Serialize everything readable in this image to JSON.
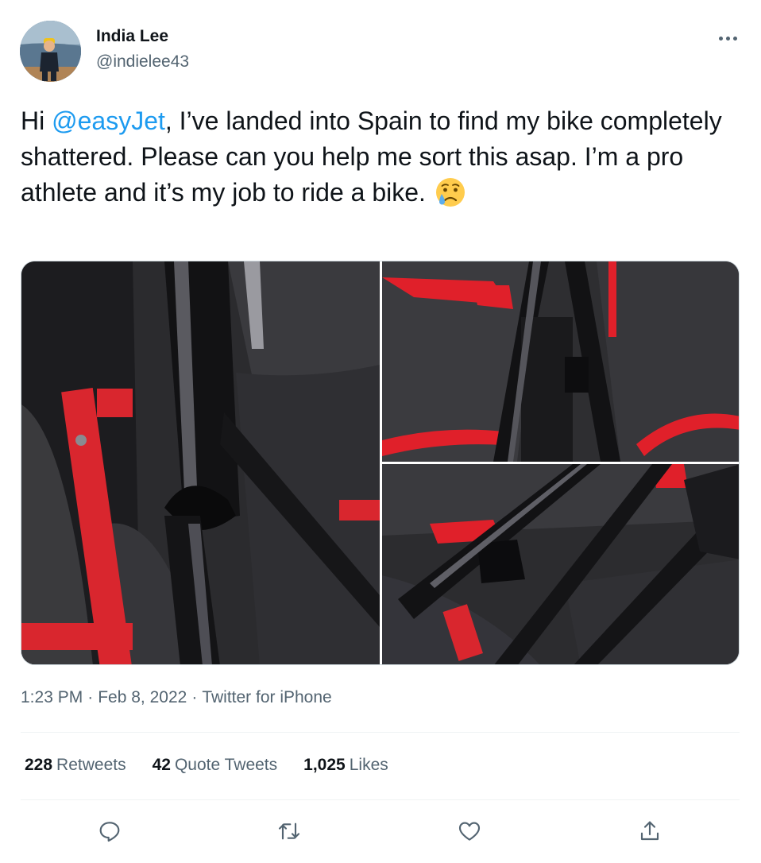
{
  "author": {
    "display_name": "India Lee",
    "handle": "@indielee43",
    "avatar_icon": "profile-photo"
  },
  "tweet": {
    "text_before_mention": "Hi ",
    "mention": "@easyJet",
    "text_after_mention": ", I’ve landed into Spain to find my bike completely shattered. Please can you help me sort this asap. I’m a pro athlete and it’s my job to ride a bike. ",
    "emoji_icon": "crying-face-emoji",
    "photos": [
      {
        "icon": "photo-shattered-bike-frame-closeup"
      },
      {
        "icon": "photo-bike-frame-in-bag"
      },
      {
        "icon": "photo-bike-frame-damaged-fork"
      }
    ]
  },
  "meta": {
    "time": "1:23 PM",
    "separator": "·",
    "date": "Feb 8, 2022",
    "source": "Twitter for iPhone"
  },
  "stats": {
    "retweets_count": "228",
    "retweets_label": "Retweets",
    "quote_count": "42",
    "quote_label": "Quote Tweets",
    "likes_count": "1,025",
    "likes_label": "Likes"
  },
  "actions": {
    "reply_icon": "reply-icon",
    "retweet_icon": "retweet-icon",
    "like_icon": "heart-icon",
    "share_icon": "share-icon"
  },
  "colors": {
    "link": "#1d9bf0",
    "text": "#0f1419",
    "secondary": "#536471",
    "divider": "#eff3f4",
    "accent_red": "#e0202a"
  }
}
